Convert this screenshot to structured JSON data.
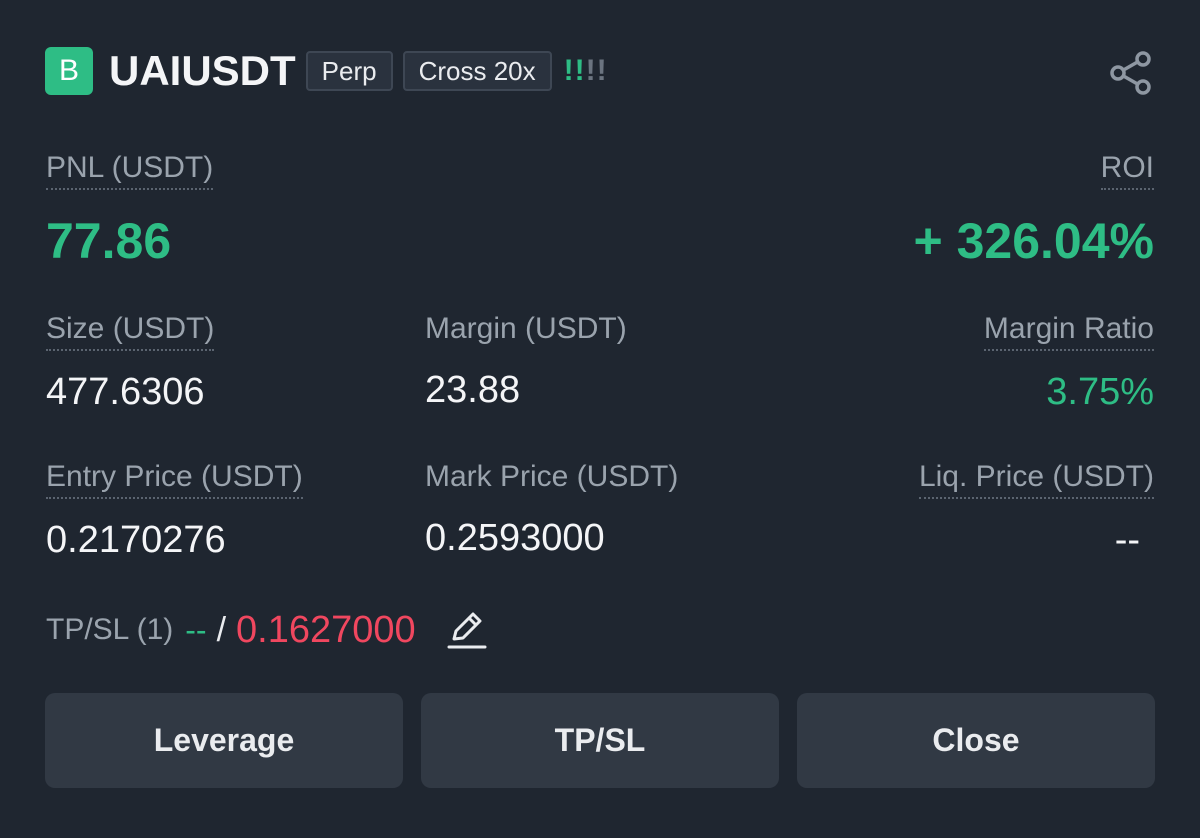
{
  "position": {
    "side_badge": "B",
    "symbol": "UAIUSDT",
    "tags": [
      "Perp",
      "Cross 20x"
    ],
    "risk_indicator": {
      "icon": "risk-level-icon",
      "filled": 2,
      "total": 4,
      "glyph": "!"
    }
  },
  "share_icon": "share-icon",
  "pnl": {
    "label": "PNL (USDT)",
    "value": "77.86"
  },
  "roi": {
    "label": "ROI",
    "value": "+ 326.04%"
  },
  "size": {
    "label": "Size (USDT)",
    "value": "477.6306"
  },
  "margin": {
    "label": "Margin (USDT)",
    "value": "23.88"
  },
  "margin_ratio": {
    "label": "Margin Ratio",
    "value": "3.75%"
  },
  "entry_price": {
    "label": "Entry Price (USDT)",
    "value": "0.2170276"
  },
  "mark_price": {
    "label": "Mark Price (USDT)",
    "value": "0.2593000"
  },
  "liq_price": {
    "label": "Liq. Price (USDT)",
    "value": "--"
  },
  "tpsl": {
    "label": "TP/SL (1)",
    "tp_value": "--",
    "separator": "/",
    "sl_value": "0.1627000",
    "edit_icon": "edit-icon"
  },
  "actions": {
    "leverage": "Leverage",
    "tpsl": "TP/SL",
    "close": "Close"
  },
  "colors": {
    "background": "#1f2630",
    "positive": "#2ebd85",
    "negative": "#f0475f",
    "button": "#313944",
    "label": "#9aa3ad"
  }
}
